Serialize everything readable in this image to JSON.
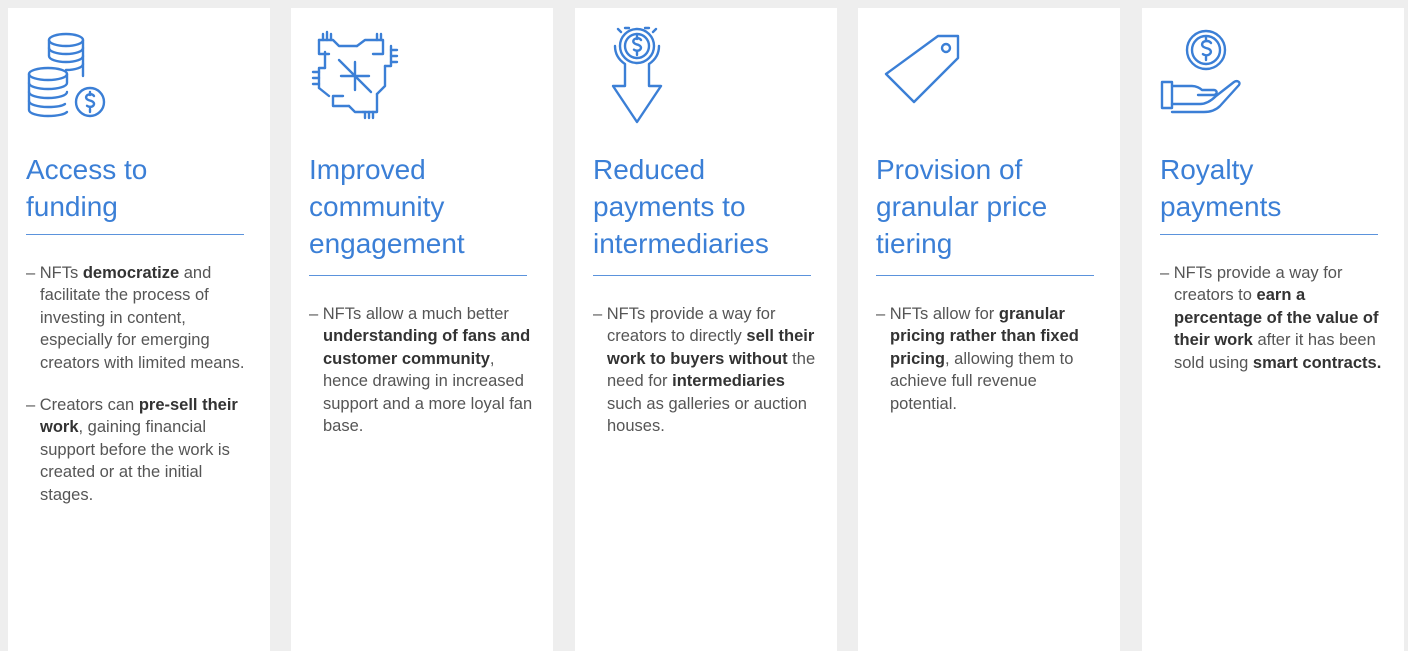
{
  "accent_color": "#3b7fd6",
  "cards": [
    {
      "icon": "coins-stack-icon",
      "title": "Access to funding",
      "bullets": [
        [
          {
            "t": "– NFTs "
          },
          {
            "t": "democratize",
            "b": true
          },
          {
            "t": " and facilitate the process of investing in content, especially for emerging creators with limited means."
          }
        ],
        [
          {
            "t": "– Creators can "
          },
          {
            "t": "pre-sell their work",
            "b": true
          },
          {
            "t": ", gaining financial support before the work is created or at the initial stages."
          }
        ]
      ]
    },
    {
      "icon": "joined-hands-icon",
      "title": "Improved community engagement",
      "bullets": [
        [
          {
            "t": "– NFTs allow a much better "
          },
          {
            "t": "understanding of fans and customer community",
            "b": true
          },
          {
            "t": ", hence drawing in increased support and a more loyal fan base."
          }
        ]
      ]
    },
    {
      "icon": "dollar-down-arrow-icon",
      "title": "Reduced payments to intermediaries",
      "bullets": [
        [
          {
            "t": "– NFTs provide a way for creators to directly "
          },
          {
            "t": "sell their work to buyers without",
            "b": true
          },
          {
            "t": " the need for "
          },
          {
            "t": "intermediaries",
            "b": true
          },
          {
            "t": " such as galleries or auction houses."
          }
        ]
      ]
    },
    {
      "icon": "price-tag-icon",
      "title": "Provision of granular price tiering",
      "bullets": [
        [
          {
            "t": "– NFTs allow for "
          },
          {
            "t": "granular pricing rather than fixed pricing",
            "b": true
          },
          {
            "t": ", allowing them to achieve full revenue potential."
          }
        ]
      ]
    },
    {
      "icon": "hand-coin-icon",
      "title": "Royalty payments",
      "bullets": [
        [
          {
            "t": "– NFTs provide a way for creators to "
          },
          {
            "t": "earn a percentage of the value of their work",
            "b": true
          },
          {
            "t": " after it has been sold using "
          },
          {
            "t": "smart contracts.",
            "b": true
          }
        ]
      ]
    }
  ]
}
